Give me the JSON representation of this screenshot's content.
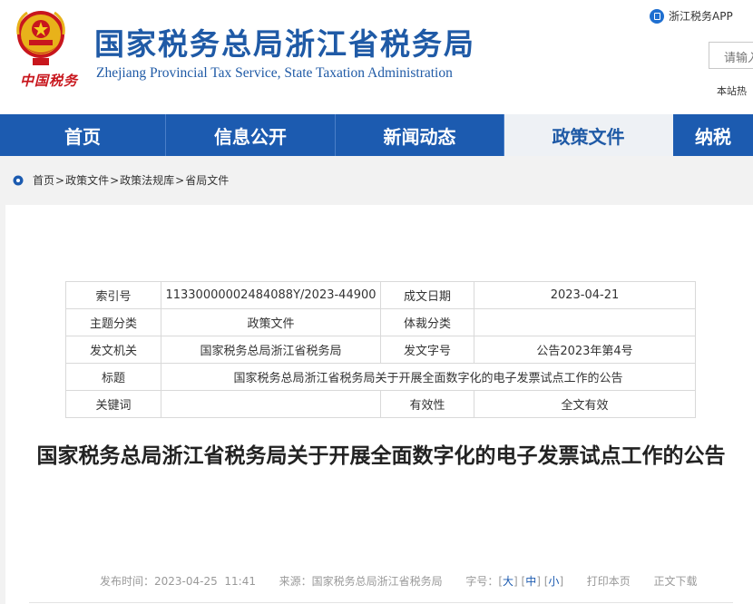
{
  "header": {
    "site_title": "国家税务总局浙江省税务局",
    "site_subtitle": "Zhejiang Provincial Tax Service, State Taxation Administration",
    "emblem_text": "中国税务",
    "app_link": "浙江税务APP",
    "search_placeholder": "请输入",
    "hot_words": "本站热"
  },
  "nav": {
    "items": [
      {
        "label": "首页"
      },
      {
        "label": "信息公开"
      },
      {
        "label": "新闻动态"
      },
      {
        "label": "政策文件"
      },
      {
        "label": "纳税"
      }
    ],
    "active": "政策文件"
  },
  "breadcrumb": {
    "items": [
      "首页",
      "政策文件",
      "政策法规库",
      "省局文件"
    ],
    "separator": ">"
  },
  "meta_table": {
    "index_label": "索引号",
    "index_value": "11330000002484088Y/2023-44900",
    "date_label": "成文日期",
    "date_value": "2023-04-21",
    "subject_label": "主题分类",
    "subject_value": "政策文件",
    "genre_label": "体裁分类",
    "genre_value": "",
    "issuer_label": "发文机关",
    "issuer_value": "国家税务总局浙江省税务局",
    "docno_label": "发文字号",
    "docno_value": "公告2023年第4号",
    "title_label": "标题",
    "title_value": "国家税务总局浙江省税务局关于开展全面数字化的电子发票试点工作的公告",
    "keywords_label": "关键词",
    "keywords_value": "",
    "validity_label": "有效性",
    "validity_value": "全文有效"
  },
  "article": {
    "title": "国家税务总局浙江省税务局关于开展全面数字化的电子发票试点工作的公告",
    "publish_label": "发布时间：",
    "publish_time": "2023-04-25  11:41",
    "source_label": "来源：",
    "source": "国家税务总局浙江省税务局",
    "font_size_label": "字号：",
    "size_large": "大",
    "size_medium": "中",
    "size_small": "小",
    "print": "打印本页",
    "download": "正文下载"
  },
  "colors": {
    "brand_blue": "#1c5bb0",
    "title_blue": "#1f5aa6",
    "emblem_red": "#c8161d"
  }
}
